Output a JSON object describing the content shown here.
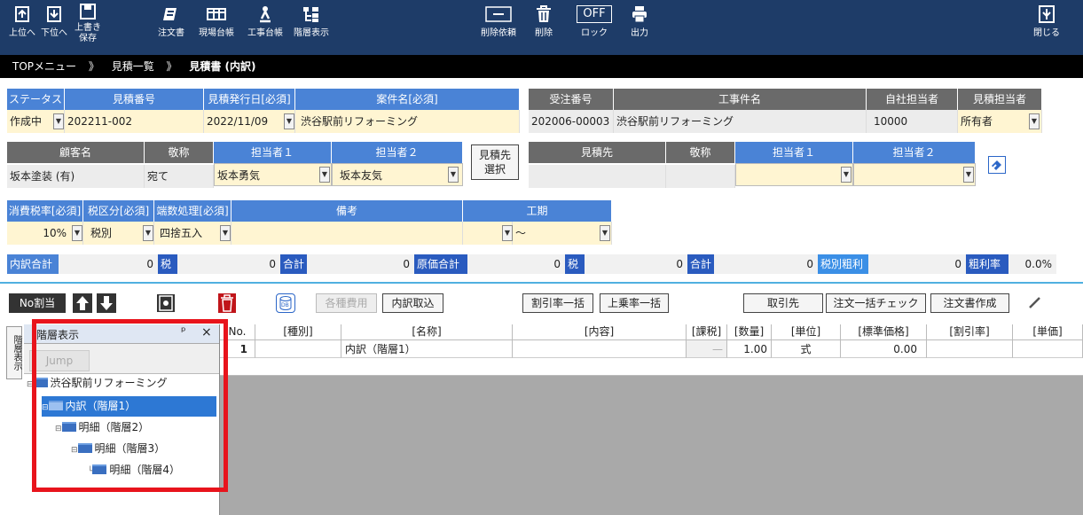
{
  "toolbar": {
    "up": "上位へ",
    "down": "下位へ",
    "overwrite_1": "上書き",
    "overwrite_2": "保存",
    "order": "注文書",
    "site_ledger": "現場台帳",
    "work_ledger": "工事台帳",
    "hier_display": "階層表示",
    "delete_request": "削除依頼",
    "delete": "削除",
    "lock": "ロック",
    "lock_badge": "OFF",
    "output": "出力",
    "close": "閉じる"
  },
  "breadcrumb": {
    "top": "TOPメニュー",
    "sep1": "》",
    "list": "見積一覧",
    "sep2": "》",
    "current": "見積書 (内訳)"
  },
  "form": {
    "h_status": "ステータス",
    "h_estno": "見積番号",
    "h_issue_date": "見積発行日[必須]",
    "h_case": "案件名[必須]",
    "status": "作成中",
    "estno": "202211-002",
    "issue_date": "2022/11/09",
    "case": "渋谷駅前リフォーミング",
    "h_order_no": "受注番号",
    "h_work_name": "工事件名",
    "h_own_person": "自社担当者",
    "h_est_person": "見積担当者",
    "order_no": "202006-00003",
    "work_name": "渋谷駅前リフォーミング",
    "own_person": "10000",
    "est_person": "所有者",
    "h_customer": "顧客名",
    "h_honorific": "敬称",
    "h_person1": "担当者１",
    "h_person2": "担当者２",
    "customer": "坂本塗装 (有)",
    "honorific": "宛て",
    "person1": "坂本勇気",
    "person2": "坂本友気",
    "select_dest_1": "見積先",
    "select_dest_2": "選択",
    "h_dest": "見積先",
    "h_dest_honorific": "敬称",
    "h_dest_person1": "担当者１",
    "h_dest_person2": "担当者２",
    "h_tax_rate": "消費税率[必須]",
    "h_tax_type": "税区分[必須]",
    "h_rounding": "端数処理[必須]",
    "h_notes": "備考",
    "h_period": "工期",
    "tax_rate": "10%",
    "tax_type": "税別",
    "rounding": "四捨五入",
    "period_sep": "～"
  },
  "summary": {
    "l_breakdown": "内訳合計",
    "v_breakdown": "0",
    "l_tax1": "税",
    "v_tax1": "0",
    "l_total1": "合計",
    "v_total1": "0",
    "l_cost": "原価合計",
    "v_cost": "0",
    "l_tax2": "税",
    "v_tax2": "0",
    "l_total2": "合計",
    "v_total2": "0",
    "l_profit": "税別粗利",
    "v_profit": "0",
    "l_rate": "粗利率",
    "v_rate": "0.0%"
  },
  "actions": {
    "no_split": "No割当",
    "expenses": "各種費用",
    "import": "内訳取込",
    "discount_all": "割引率一括",
    "markup_all": "上乗率一括",
    "supplier": "取引先",
    "order_check": "注文一括チェック",
    "order_create": "注文書作成"
  },
  "table": {
    "headers": [
      "No.",
      "[種別]",
      "[名称]",
      "[内容]",
      "[課税]",
      "[数量]",
      "[単位]",
      "[標準価格]",
      "[割引率]",
      "[単価]"
    ],
    "row": {
      "no": "1",
      "type": "",
      "name": "内訳（階層1）",
      "content": "",
      "tax": "—",
      "qty": "1.00",
      "unit": "式",
      "price": "0.00",
      "disc": "",
      "unit_price": ""
    }
  },
  "tree_panel": {
    "side_tab": "階層表示",
    "title": "階層表示",
    "pin": "ᵖ",
    "close": "×",
    "jump": "Jump",
    "items": [
      "渋谷駅前リフォーミング",
      "内訳（階層1）",
      "明細（階層2）",
      "明細（階層3）",
      "明細（階層4）"
    ]
  },
  "colors": {
    "toolbar": "#1e3c68",
    "header_blue": "#4a83d6",
    "header_gray": "#6a6a6a",
    "highlight": "#e8141c"
  }
}
